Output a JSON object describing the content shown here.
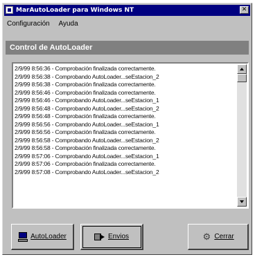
{
  "window": {
    "title": "MarAutoLoader para Windows NT",
    "close_glyph": "✕"
  },
  "menu": [
    {
      "label": "Configuración"
    },
    {
      "label": "Ayuda"
    }
  ],
  "section": {
    "header": "Control de AutoLoader"
  },
  "log": {
    "lines": [
      "2/9/99 8:56:36 - Comprobación finalizada correctamente.",
      "2/9/99 8:56:38 - Comprobando AutoLoader...seEstacion_2",
      "2/9/99 8:56:38 - Comprobación finalizada correctamente.",
      "2/9/99 8:56:46 - Comprobación finalizada correctamente.",
      "2/9/99 8:56:46 - Comprobando AutoLoader...seEstacion_1",
      "2/9/99 8:56:48 - Comprobando AutoLoader...seEstacion_2",
      "2/9/99 8:56:48 - Comprobación finalizada correctamente.",
      "2/9/99 8:56:56 - Comprobando AutoLoader...seEstacion_1",
      "2/9/99 8:56:56 - Comprobación finalizada correctamente.",
      "2/9/99 8:56:58 - Comprobando AutoLoader...seEstacion_2",
      "2/9/99 8:56:58 - Comprobación finalizada correctamente.",
      "2/9/99 8:57:06 - Comprobando AutoLoader...seEstacion_1",
      "2/9/99 8:57:06 - Comprobación finalizada correctamente.",
      "2/9/99 8:57:08 - Comprobando AutoLoader...seEstacion_2"
    ]
  },
  "buttons": {
    "autoloader": {
      "label": "AutoLoader",
      "icon": "computer-icon"
    },
    "envios": {
      "label": "Envios",
      "icon": "play-icon"
    },
    "cerrar": {
      "label": "Cerrar",
      "icon": "gear-icon"
    }
  },
  "colors": {
    "titlebar": "#000080",
    "face": "#c0c0c0",
    "header": "#808080"
  }
}
